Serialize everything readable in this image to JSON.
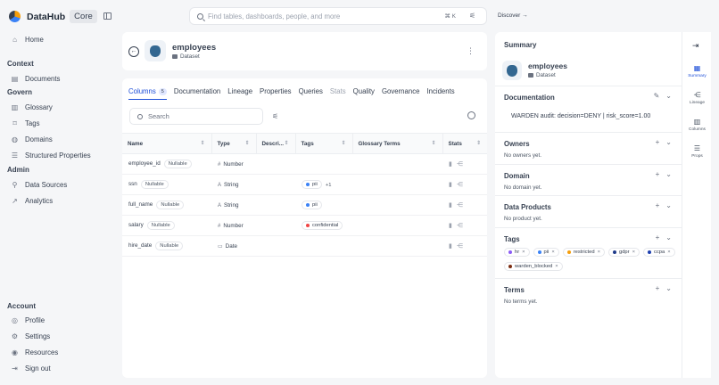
{
  "brand": {
    "name": "DataHub",
    "tag": "Core"
  },
  "nav": {
    "home": "Home",
    "context_label": "Context",
    "documents": "Documents",
    "govern_label": "Govern",
    "glossary": "Glossary",
    "tags": "Tags",
    "domains": "Domains",
    "structured_properties": "Structured Properties",
    "admin_label": "Admin",
    "data_sources": "Data Sources",
    "analytics": "Analytics",
    "account_label": "Account",
    "profile": "Profile",
    "settings": "Settings",
    "resources": "Resources",
    "sign_out": "Sign out"
  },
  "search": {
    "placeholder": "Find tables, dashboards, people, and more",
    "shortcut": "⌘ K"
  },
  "discover": "Discover →",
  "entity": {
    "name": "employees",
    "type": "Dataset"
  },
  "tabs": [
    {
      "label": "Columns",
      "count": "5"
    },
    {
      "label": "Documentation"
    },
    {
      "label": "Lineage"
    },
    {
      "label": "Properties"
    },
    {
      "label": "Queries"
    },
    {
      "label": "Stats"
    },
    {
      "label": "Quality"
    },
    {
      "label": "Governance"
    },
    {
      "label": "Incidents"
    }
  ],
  "columns_search": {
    "placeholder": "Search"
  },
  "table": {
    "headers": [
      "Name",
      "Type",
      "Descri...",
      "Tags",
      "Glossary Terms",
      "Stats"
    ],
    "rows": [
      {
        "name": "employee_id",
        "nullable": "Nullable",
        "type_icon": "#",
        "type": "Number",
        "tag": "",
        "tag_color": "",
        "extra": ""
      },
      {
        "name": "ssn",
        "nullable": "Nullable",
        "type_icon": "A",
        "type": "String",
        "tag": "pii",
        "tag_color": "#3b82f6",
        "extra": "+1"
      },
      {
        "name": "full_name",
        "nullable": "Nullable",
        "type_icon": "A",
        "type": "String",
        "tag": "pii",
        "tag_color": "#3b82f6",
        "extra": ""
      },
      {
        "name": "salary",
        "nullable": "Nullable",
        "type_icon": "#",
        "type": "Number",
        "tag": "confidential",
        "tag_color": "#ef4444",
        "extra": ""
      },
      {
        "name": "hire_date",
        "nullable": "Nullable",
        "type_icon": "▭",
        "type": "Date",
        "tag": "",
        "tag_color": "",
        "extra": ""
      }
    ]
  },
  "summary": {
    "title": "Summary",
    "documentation": {
      "title": "Documentation",
      "text": "WARDEN audit: decision=DENY | risk_score=1.00"
    },
    "owners": {
      "title": "Owners",
      "empty": "No owners yet."
    },
    "domain": {
      "title": "Domain",
      "empty": "No domain yet."
    },
    "data_products": {
      "title": "Data Products",
      "empty": "No product yet."
    },
    "tags": {
      "title": "Tags",
      "items": [
        {
          "label": "hr",
          "color": "#8b5cf6"
        },
        {
          "label": "pii",
          "color": "#3b82f6"
        },
        {
          "label": "restricted",
          "color": "#f59e0b"
        },
        {
          "label": "gdpr",
          "color": "#1e3a8a"
        },
        {
          "label": "ccpa",
          "color": "#1e40af"
        },
        {
          "label": "warden_blocked",
          "color": "#7c2d12"
        }
      ]
    },
    "terms": {
      "title": "Terms",
      "empty": "No terms yet."
    }
  },
  "rail": {
    "summary": "Summary",
    "lineage": "Lineage",
    "columns": "Columns",
    "props": "Props"
  }
}
